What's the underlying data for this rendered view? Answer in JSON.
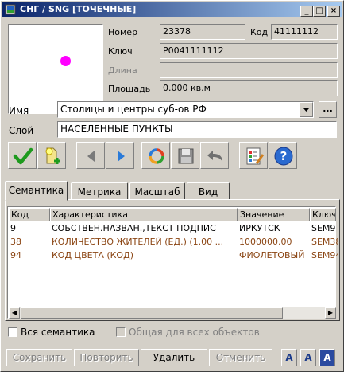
{
  "window": {
    "title": "СНГ / SNG [ТОЧЕЧНЫЕ]",
    "controls": [
      "_",
      "□",
      "×"
    ]
  },
  "preview": {
    "marker_color": "#ff00ff"
  },
  "props": {
    "nomer_label": "Номер",
    "nomer_value": "23378",
    "kod_label": "Код",
    "kod_value": "41111112",
    "klyuch_label": "Ключ",
    "klyuch_value": "P0041111112",
    "dlina_label": "Длина",
    "dlina_value": "",
    "ploshad_label": "Площадь",
    "ploshad_value": "0.000 кв.м"
  },
  "name_row": {
    "label": "Имя",
    "value": "Столицы и центры суб-ов РФ",
    "more_button": "..."
  },
  "layer_row": {
    "label": "Слой",
    "value": "НАСЕЛЕННЫЕ ПУНКТЫ"
  },
  "toolbar": {
    "icons": [
      "checkmark-icon",
      "add-object-icon",
      "arrow-left-icon",
      "arrow-right-icon",
      "refresh-icon",
      "save-icon",
      "undo-icon",
      "edit-list-icon",
      "help-icon"
    ],
    "help_glyph": "?"
  },
  "tabs": [
    "Семантика",
    "Метрика",
    "Масштаб",
    "Вид"
  ],
  "table": {
    "columns": [
      "Код",
      "Характеристика",
      "Значение",
      "Ключ"
    ],
    "rows": [
      {
        "code": "9",
        "name": "СОБСТВЕН.НАЗВАН.,ТЕКСТ ПОДПИС",
        "value": "ИРКУТСК",
        "key": "SEM9",
        "color": "#000000"
      },
      {
        "code": "38",
        "name": "КОЛИЧЕСТВО ЖИТЕЛЕЙ (ЕД.)   (1.00 ...",
        "value": "1000000.00",
        "key": "SEM38",
        "color": "#8b4513"
      },
      {
        "code": "94",
        "name": "КОД ЦВЕТА (КОД)",
        "value": "ФИОЛЕТОВЫЙ",
        "key": "SEM94",
        "color": "#8b4513"
      }
    ],
    "scroll_left": "◀",
    "scroll_right": "▶"
  },
  "options": {
    "all_semantics": "Вся семантика",
    "common_for_all": "Общая для всех объектов"
  },
  "buttons": {
    "save": "Сохранить",
    "repeat": "Повторить",
    "delete": "Удалить",
    "cancel": "Отменить",
    "font_a1": "A",
    "font_a2": "A",
    "font_a3": "A"
  },
  "colors": {
    "title_start": "#0a246a",
    "title_end": "#a6caf0",
    "semantic_brown": "#8b4513",
    "face": "#d4d0c8"
  }
}
